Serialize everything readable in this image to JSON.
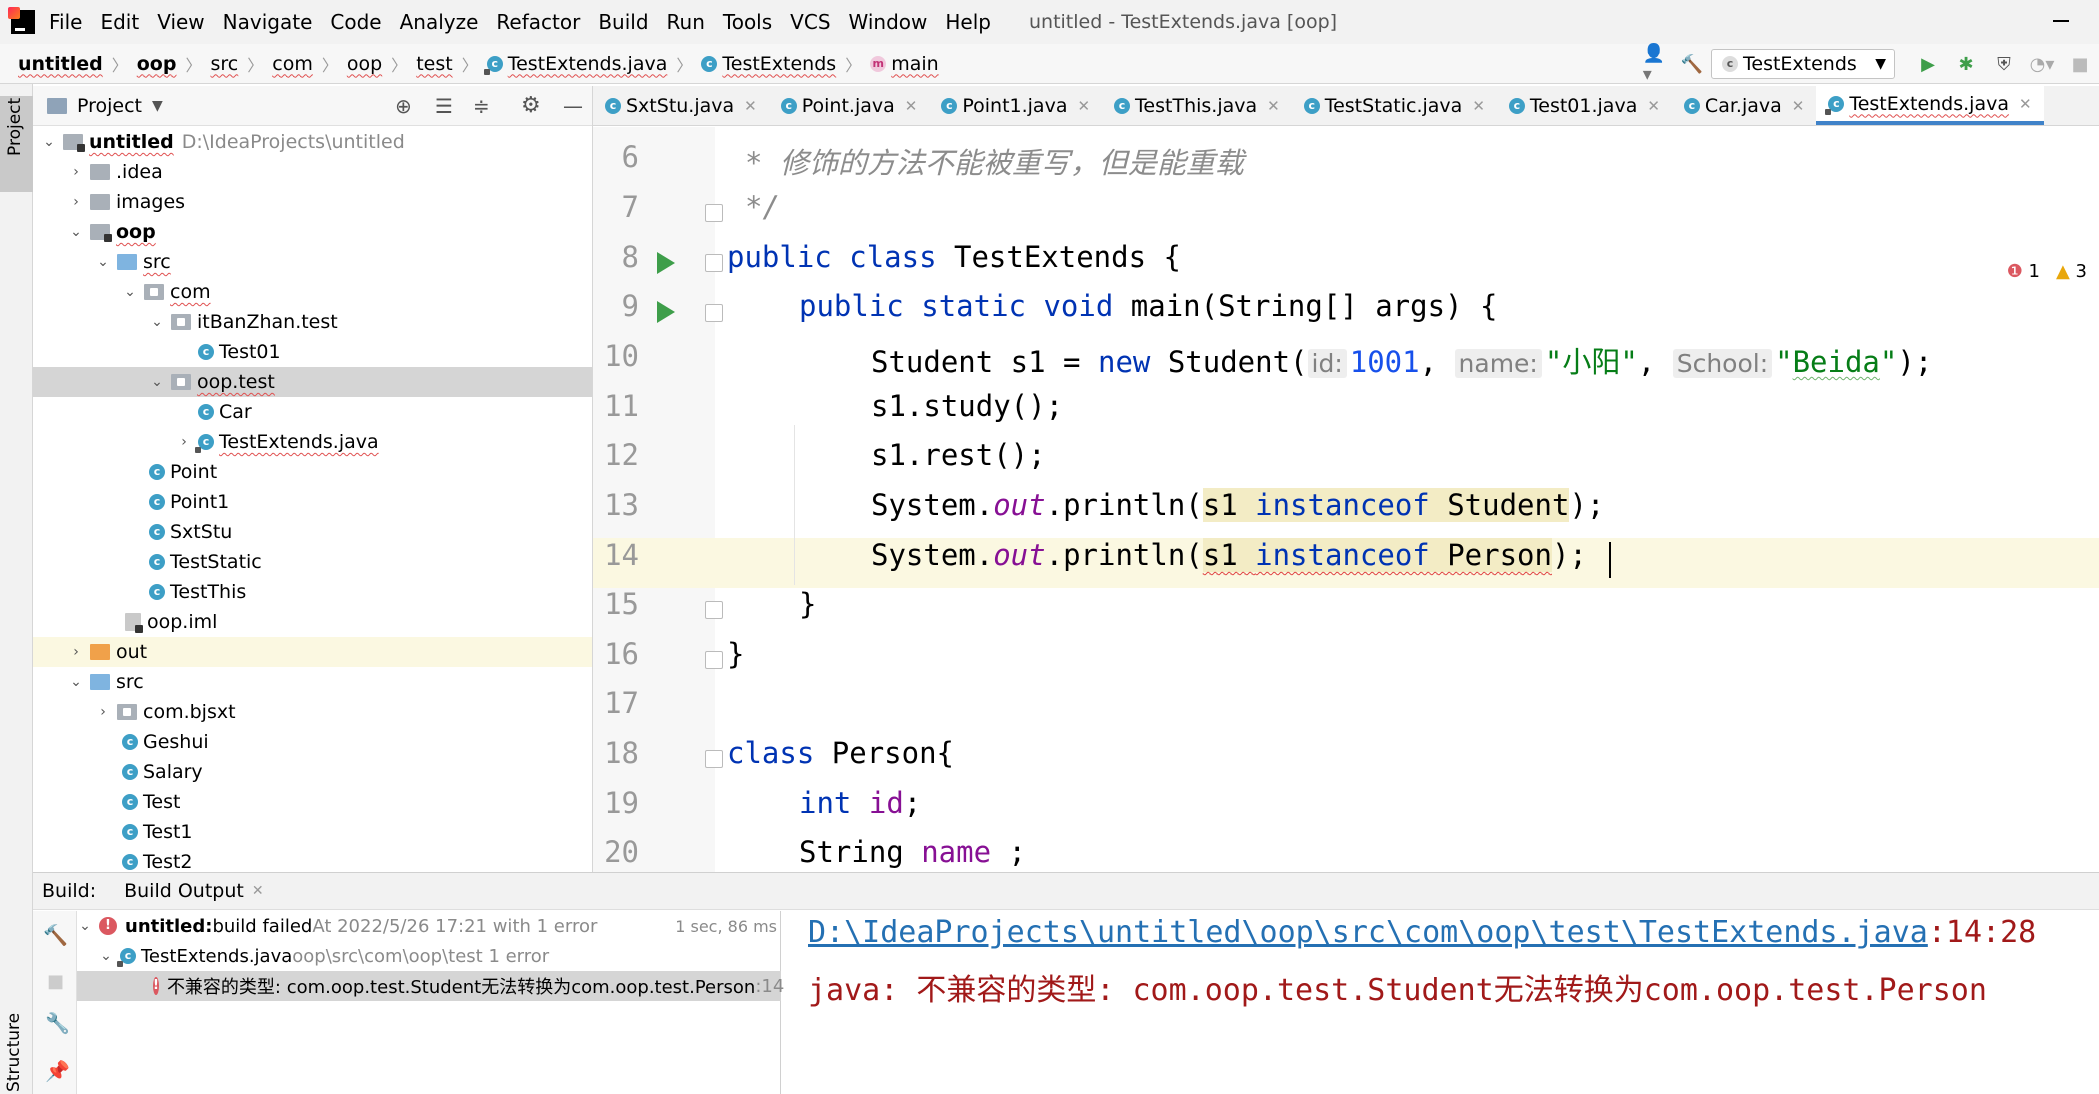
{
  "menubar": {
    "items": [
      "File",
      "Edit",
      "View",
      "Navigate",
      "Code",
      "Analyze",
      "Refactor",
      "Build",
      "Run",
      "Tools",
      "VCS",
      "Window",
      "Help"
    ],
    "window_title": "untitled - TestExtends.java [oop]"
  },
  "navbar": {
    "crumbs": [
      "untitled",
      "oop",
      "src",
      "com",
      "oop",
      "test",
      "TestExtends.java",
      "TestExtends",
      "main"
    ],
    "run_config": "TestExtends"
  },
  "stripe": {
    "project": "Project",
    "structure": "Structure"
  },
  "project": {
    "header": "Project",
    "tree": [
      {
        "label": "untitled",
        "extra": "D:\\IdeaProjects\\untitled"
      },
      {
        "label": ".idea"
      },
      {
        "label": "images"
      },
      {
        "label": "oop"
      },
      {
        "label": "src"
      },
      {
        "label": "com"
      },
      {
        "label": "itBanZhan.test"
      },
      {
        "label": "Test01"
      },
      {
        "label": "oop.test"
      },
      {
        "label": "Car"
      },
      {
        "label": "TestExtends.java"
      },
      {
        "label": "Point"
      },
      {
        "label": "Point1"
      },
      {
        "label": "SxtStu"
      },
      {
        "label": "TestStatic"
      },
      {
        "label": "TestThis"
      },
      {
        "label": "oop.iml"
      },
      {
        "label": "out"
      },
      {
        "label": "src"
      },
      {
        "label": "com.bjsxt"
      },
      {
        "label": "Geshui"
      },
      {
        "label": "Salary"
      },
      {
        "label": "Test"
      },
      {
        "label": "Test1"
      },
      {
        "label": "Test2"
      }
    ]
  },
  "tabs": [
    "SxtStu.java",
    "Point.java",
    "Point1.java",
    "TestThis.java",
    "TestStatic.java",
    "Test01.java",
    "Car.java",
    "TestExtends.java"
  ],
  "editor": {
    "error_count": "1",
    "warning_count": "3",
    "line_numbers": [
      "6",
      "7",
      "8",
      "9",
      "10",
      "11",
      "12",
      "13",
      "14",
      "15",
      "16",
      "17",
      "18",
      "19",
      "20"
    ],
    "code": {
      "l6": "* 修饰的方法不能被重写，但是能重载",
      "l7": "*/",
      "l8_kw1": "public",
      "l8_kw2": "class",
      "l8_rest": " TestExtends {",
      "l9_kw1": "public",
      "l9_kw2": "static",
      "l9_kw3": "void",
      "l9_rest": " main(String[] args) {",
      "l10_a": "Student s1 = ",
      "l10_new": "new",
      "l10_b": " Student(",
      "l10_hint1": "id:",
      "l10_v1": "1001",
      "l10_hint2": "name:",
      "l10_v2": "\"小阳\"",
      "l10_hint3": "School:",
      "l10_v3a": "\"",
      "l10_v3b": "Beida",
      "l10_v3c": "\"",
      "l10_end": ");",
      "l11": "s1.study();",
      "l12": "s1.rest();",
      "l13_a": "System.",
      "l13_out": "out",
      "l13_b": ".println(",
      "l13_s1": "s1 ",
      "l13_io": "instanceof",
      "l13_ty": " Student",
      "l13_end": ");",
      "l14_a": "System.",
      "l14_out": "out",
      "l14_b": ".println(",
      "l14_s1": "s1 ",
      "l14_io": "instanceof",
      "l14_ty": " Person",
      "l14_end": ");",
      "l15": "}",
      "l16": "}",
      "l18_kw": "class",
      "l18_rest": " Person{",
      "l19_kw": "int",
      "l19_fld": "id",
      "l19_end": ";",
      "l20_a": "String ",
      "l20_fld": "name",
      "l20_end": " ;"
    }
  },
  "build": {
    "label": "Build:",
    "tab": "Build Output",
    "root_name": "untitled:",
    "root_msg": " build failed",
    "root_time": " At 2022/5/26 17:21 with 1 error",
    "root_duration": "1 sec, 86 ms",
    "file": "TestExtends.java",
    "file_path": " oop\\src\\com\\oop\\test 1 error",
    "error_msg": "不兼容的类型: com.oop.test.Student无法转换为com.oop.test.Person",
    "error_line": " :14",
    "output_path": "D:\\IdeaProjects\\untitled\\oop\\src\\com\\oop\\test\\TestExtends.java",
    "output_pos": ":14:28",
    "output_msg": "java: 不兼容的类型: com.oop.test.Student无法转换为com.oop.test.Person"
  },
  "colors": {
    "keyword": "#0033b3",
    "string": "#067d17",
    "number": "#1750eb",
    "field": "#871094",
    "error": "#db5860",
    "link": "#2470b3"
  }
}
